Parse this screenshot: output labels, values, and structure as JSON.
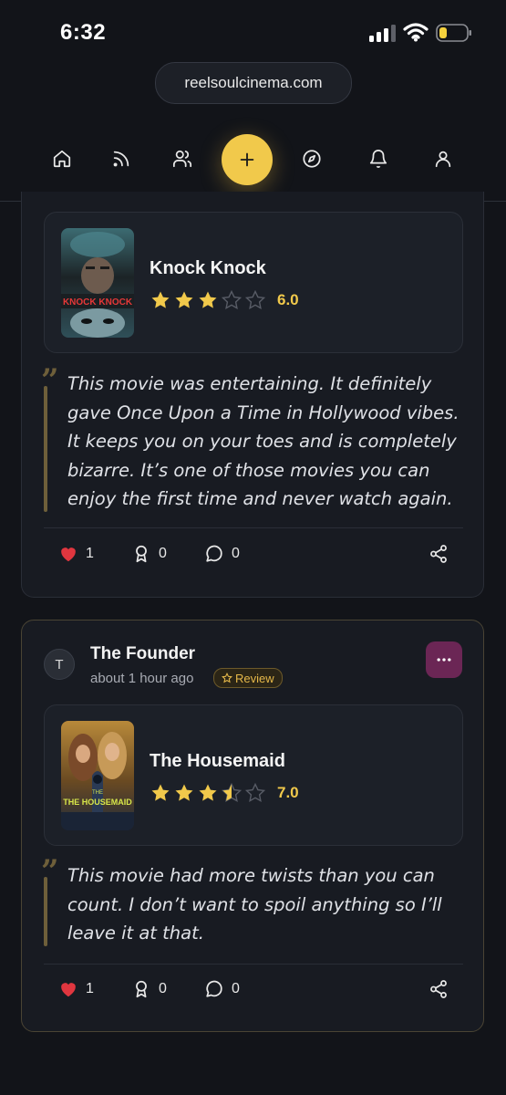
{
  "status_bar": {
    "time": "6:32"
  },
  "browser": {
    "url": "reelsoulcinema.com"
  },
  "nav": {
    "items": [
      "home-icon",
      "feed-icon",
      "friends-icon",
      "add-icon",
      "explore-icon",
      "notifications-icon",
      "profile-icon"
    ],
    "accent": "#f1c94b"
  },
  "posts": [
    {
      "movie": {
        "title": "Knock Knock",
        "rating": "6.0",
        "stars": 3,
        "poster_text": "KNOCK KNOCK"
      },
      "review": "This movie was entertaining. It definitely gave Once Upon a Time in Hollywood vibes. It keeps you on your toes and is completely bizarre. It’s one of those movies you can enjoy the first time and never watch again.",
      "likes": "1",
      "awards": "0",
      "comments": "0"
    },
    {
      "avatar_initial": "T",
      "user": "The Founder",
      "time_ago": "about 1 hour ago",
      "badge": "Review",
      "movie": {
        "title": "The Housemaid",
        "rating": "7.0",
        "stars": 3.5,
        "poster_text": "THE HOUSEMAID",
        "poster_text_top": "THE"
      },
      "review": "This movie had more twists than you can count. I don’t want to spoil anything so I’ll leave it at that.",
      "likes": "1",
      "awards": "0",
      "comments": "0"
    }
  ],
  "colors": {
    "star": "#f1c94b",
    "heart": "#e0363f",
    "background": "#121419",
    "card": "#181b22"
  }
}
